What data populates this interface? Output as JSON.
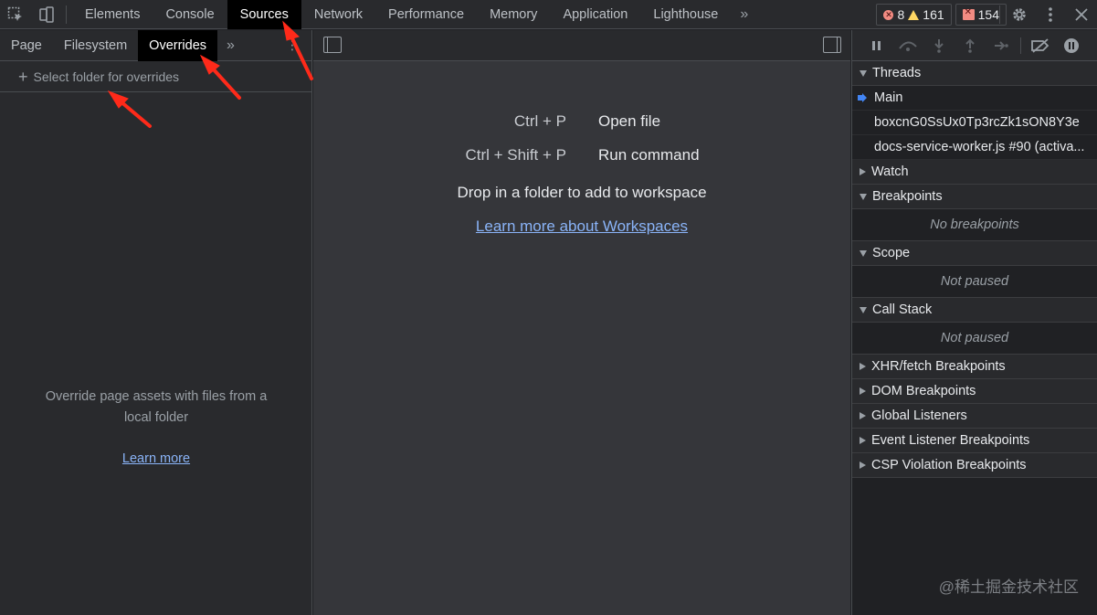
{
  "top_tabs": [
    {
      "label": "Elements"
    },
    {
      "label": "Console"
    },
    {
      "label": "Sources"
    },
    {
      "label": "Network"
    },
    {
      "label": "Performance"
    },
    {
      "label": "Memory"
    },
    {
      "label": "Application"
    },
    {
      "label": "Lighthouse"
    }
  ],
  "counts": {
    "errors": "8",
    "warnings": "161",
    "issues": "154"
  },
  "navigator": {
    "tabs": [
      {
        "label": "Page"
      },
      {
        "label": "Filesystem"
      },
      {
        "label": "Overrides"
      }
    ],
    "select_folder": "Select folder for overrides",
    "empty_message": "Override page assets with files from a local folder",
    "learn_more": "Learn more"
  },
  "editor": {
    "shortcuts": [
      {
        "keys": "Ctrl + P",
        "action": "Open file"
      },
      {
        "keys": "Ctrl + Shift + P",
        "action": "Run command"
      }
    ],
    "drop_text": "Drop in a folder to add to workspace",
    "workspace_link": "Learn more about Workspaces"
  },
  "debugger": {
    "threads_header": "Threads",
    "threads": [
      {
        "name": "Main"
      },
      {
        "name": "boxcnG0SsUx0Tp3rcZk1sON8Y3e"
      },
      {
        "name": "docs-service-worker.js #90 (activa..."
      }
    ],
    "watch_header": "Watch",
    "breakpoints_header": "Breakpoints",
    "no_breakpoints": "No breakpoints",
    "scope_header": "Scope",
    "scope_empty": "Not paused",
    "callstack_header": "Call Stack",
    "callstack_empty": "Not paused",
    "collapsed_panes": [
      {
        "label": "XHR/fetch Breakpoints"
      },
      {
        "label": "DOM Breakpoints"
      },
      {
        "label": "Global Listeners"
      },
      {
        "label": "Event Listener Breakpoints"
      },
      {
        "label": "CSP Violation Breakpoints"
      }
    ]
  },
  "watermark": "@稀土掘金技术社区",
  "colors": {
    "accent": "#8ab4f8",
    "annotation_arrow": "#ff2a1a"
  }
}
